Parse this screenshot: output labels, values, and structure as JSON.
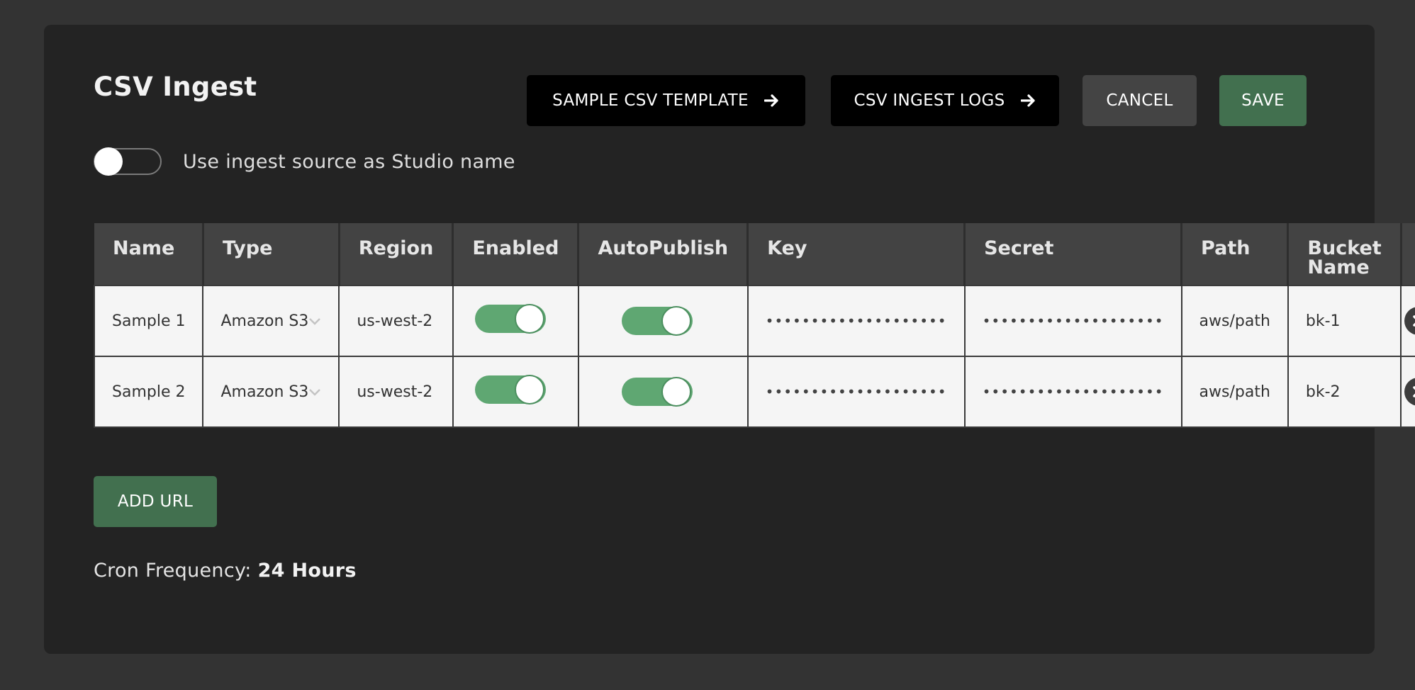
{
  "dialog": {
    "title": "CSV Ingest",
    "sample_template_label": "SAMPLE CSV TEMPLATE",
    "ingest_logs_label": "CSV INGEST LOGS",
    "cancel_label": "CANCEL",
    "save_label": "SAVE",
    "studio_name_toggle_label": "Use ingest source as Studio name",
    "studio_name_toggle_on": false,
    "add_url_label": "ADD URL",
    "cron_label": "Cron Frequency:",
    "cron_value": "24 Hours"
  },
  "table": {
    "headers": [
      "Name",
      "Type",
      "Region",
      "Enabled",
      "AutoPublish",
      "Key",
      "Secret",
      "Path",
      "Bucket Name"
    ],
    "rows": [
      {
        "name": "Sample 1",
        "type": "Amazon S3",
        "region": "us-west-2",
        "enabled": true,
        "autopublish": true,
        "key": "••••••••••••••••••••",
        "secret": "••••••••••••••••••••",
        "path": "aws/path",
        "bucket": "bk-1"
      },
      {
        "name": "Sample 2",
        "type": "Amazon S3",
        "region": "us-west-2",
        "enabled": true,
        "autopublish": true,
        "key": "••••••••••••••••••••",
        "secret": "••••••••••••••••••••",
        "path": "aws/path",
        "bucket": "bk-2"
      }
    ]
  },
  "icons": {
    "arrow": "arrow-right-icon",
    "remove": "close-circle-icon",
    "dropdown": "chevron-down-icon"
  },
  "colors": {
    "accent_green": "#42704f",
    "toggle_green": "#5fa772",
    "card_bg": "#232323",
    "page_bg": "#333333"
  }
}
